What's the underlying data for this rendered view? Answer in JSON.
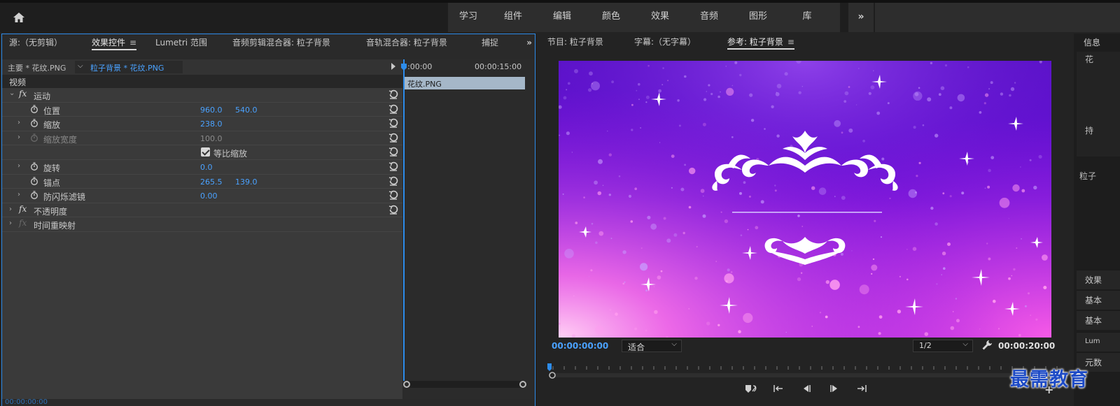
{
  "workspaces": [
    "学习",
    "组件",
    "编辑",
    "颜色",
    "效果",
    "音频",
    "图形",
    "库"
  ],
  "workspace_more": "»",
  "left_tabs": [
    {
      "label": "源:（无剪辑）"
    },
    {
      "label": "效果控件",
      "active": true
    },
    {
      "label": "Lumetri 范围"
    },
    {
      "label": "音频剪辑混合器: 粒子背景"
    },
    {
      "label": "音轨混合器: 粒子背景"
    },
    {
      "label": "捕捉"
    }
  ],
  "left_tabs_more": "»",
  "effect_controls": {
    "master_clip": "主要 * 花纹.PNG",
    "sequence_clip": "粒子背景 * 花纹.PNG",
    "section": "视频",
    "motion": "运动",
    "position_label": "位置",
    "position_x": "960.0",
    "position_y": "540.0",
    "scale_label": "缩放",
    "scale_value": "238.0",
    "scale_width_label": "缩放宽度",
    "scale_width_value": "100.0",
    "uniform_scale_label": "等比缩放",
    "rotation_label": "旋转",
    "rotation_value": "0.0",
    "anchor_label": "锚点",
    "anchor_x": "265.5",
    "anchor_y": "139.0",
    "anti_flicker_label": "防闪烁滤镜",
    "anti_flicker_value": "0.00",
    "opacity": "不透明度",
    "time_remap": "时间重映射",
    "timeline_start": ":00:00",
    "timeline_end": "00:00:15:00",
    "timeline_clip": "花纹.PNG",
    "bottom_timecode": "00:00:00:00"
  },
  "monitor_tabs": [
    {
      "label": "节目: 粒子背景"
    },
    {
      "label": "字幕:（无字幕）"
    },
    {
      "label": "参考: 粒子背景",
      "active": true
    }
  ],
  "monitor": {
    "current_tc": "00:00:00:00",
    "fit": "适合",
    "resolution": "1/2",
    "duration_tc": "00:00:20:00"
  },
  "info_panel": {
    "tab": "信息",
    "items": [
      "花",
      "持",
      "粒子"
    ],
    "blocks": [
      "效果",
      "基本",
      "基本",
      "Lum",
      "元数"
    ]
  },
  "watermark": "最需教育",
  "colors": {
    "accent": "#2d8ceb",
    "value_blue": "#4aa2ff",
    "purple_bg": "#7a1ce0"
  }
}
